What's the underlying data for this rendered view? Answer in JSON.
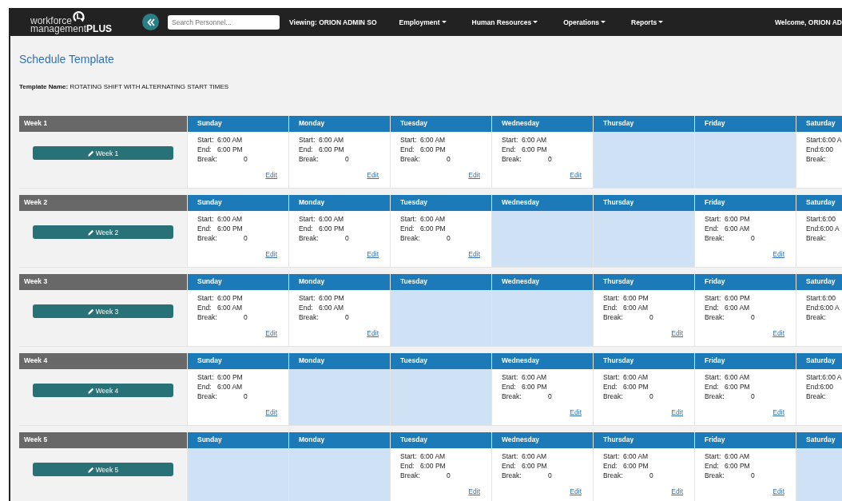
{
  "navbar": {
    "logo": {
      "line_1": "workforce",
      "line_2": "management",
      "line_3": "PLUS"
    },
    "search": {
      "placeholder": "Search Personnel..."
    },
    "viewing": "Viewing: ORION ADMIN SO",
    "menus": [
      "Employment",
      "Human Resources",
      "Operations",
      "Reports"
    ],
    "welcome": "Welcome, ORION AD"
  },
  "page_title": "Schedule Template",
  "template_name": {
    "label": "Template Name:",
    "value": "ROTATING SHIFT WITH ALTERNATING START TIMES"
  },
  "weeks": [
    {
      "label": "Week 1",
      "button": "Week 1",
      "days": [
        {
          "day": "Sunday",
          "kind": "shift",
          "start_label": "Start:",
          "start": "6:00 AM",
          "end_label": "End:",
          "end": "6:00 PM",
          "break_label": "Break:",
          "break": "0",
          "edit": "Edit"
        },
        {
          "day": "Monday",
          "kind": "shift",
          "start_label": "Start:",
          "start": "6:00 AM",
          "end_label": "End:",
          "end": "6:00 PM",
          "break_label": "Break:",
          "break": "0",
          "edit": "Edit"
        },
        {
          "day": "Tuesday",
          "kind": "shift",
          "start_label": "Start:",
          "start": "6:00 AM",
          "end_label": "End:",
          "end": "6:00 PM",
          "break_label": "Break:",
          "break": "0",
          "edit": "Edit"
        },
        {
          "day": "Wednesday",
          "kind": "shift",
          "start_label": "Start:",
          "start": "6:00 AM",
          "end_label": "End:",
          "end": "6:00 PM",
          "break_label": "Break:",
          "break": "0",
          "edit": "Edit"
        },
        {
          "day": "Thursday",
          "kind": "off"
        },
        {
          "day": "Friday",
          "kind": "off"
        },
        {
          "day": "Saturday",
          "kind": "shift",
          "start_label": "Start:",
          "start": "6:00 A",
          "end_label": "End:",
          "end": "6:00",
          "break_label": "Break:"
        }
      ]
    },
    {
      "label": "Week 2",
      "button": "Week 2",
      "days": [
        {
          "day": "Sunday",
          "kind": "shift",
          "start_label": "Start:",
          "start": "6:00 AM",
          "end_label": "End:",
          "end": "6:00 PM",
          "break_label": "Break:",
          "break": "0",
          "edit": "Edit"
        },
        {
          "day": "Monday",
          "kind": "shift",
          "start_label": "Start:",
          "start": "6:00 AM",
          "end_label": "End:",
          "end": "6:00 PM",
          "break_label": "Break:",
          "break": "0",
          "edit": "Edit"
        },
        {
          "day": "Tuesday",
          "kind": "shift",
          "start_label": "Start:",
          "start": "6:00 AM",
          "end_label": "End:",
          "end": "6:00 PM",
          "break_label": "Break:",
          "break": "0",
          "edit": "Edit"
        },
        {
          "day": "Wednesday",
          "kind": "off"
        },
        {
          "day": "Thursday",
          "kind": "off"
        },
        {
          "day": "Friday",
          "kind": "shift",
          "start_label": "Start:",
          "start": "6:00 PM",
          "end_label": "End:",
          "end": "6:00 AM",
          "break_label": "Break:",
          "break": "0",
          "edit": "Edit"
        },
        {
          "day": "Saturday",
          "kind": "shift",
          "start_label": "Start:",
          "start": "6:00",
          "end_label": "End:",
          "end": "6:00 A",
          "break_label": "Break:"
        }
      ]
    },
    {
      "label": "Week 3",
      "button": "Week 3",
      "days": [
        {
          "day": "Sunday",
          "kind": "shift",
          "start_label": "Start:",
          "start": "6:00 PM",
          "end_label": "End:",
          "end": "6:00 AM",
          "break_label": "Break:",
          "break": "0",
          "edit": "Edit"
        },
        {
          "day": "Monday",
          "kind": "shift",
          "start_label": "Start:",
          "start": "6:00 PM",
          "end_label": "End:",
          "end": "6:00 AM",
          "break_label": "Break:",
          "break": "0",
          "edit": "Edit"
        },
        {
          "day": "Tuesday",
          "kind": "off"
        },
        {
          "day": "Wednesday",
          "kind": "off"
        },
        {
          "day": "Thursday",
          "kind": "shift",
          "start_label": "Start:",
          "start": "6:00 PM",
          "end_label": "End:",
          "end": "6:00 AM",
          "break_label": "Break:",
          "break": "0",
          "edit": "Edit"
        },
        {
          "day": "Friday",
          "kind": "shift",
          "start_label": "Start:",
          "start": "6:00 PM",
          "end_label": "End:",
          "end": "6:00 AM",
          "break_label": "Break:",
          "break": "0",
          "edit": "Edit"
        },
        {
          "day": "Saturday",
          "kind": "shift",
          "start_label": "Start:",
          "start": "6:00",
          "end_label": "End:",
          "end": "6:00 A",
          "break_label": "Break:"
        }
      ]
    },
    {
      "label": "Week 4",
      "button": "Week 4",
      "days": [
        {
          "day": "Sunday",
          "kind": "shift",
          "start_label": "Start:",
          "start": "6:00 PM",
          "end_label": "End:",
          "end": "6:00 AM",
          "break_label": "Break:",
          "break": "0",
          "edit": "Edit"
        },
        {
          "day": "Monday",
          "kind": "off"
        },
        {
          "day": "Tuesday",
          "kind": "off"
        },
        {
          "day": "Wednesday",
          "kind": "shift",
          "start_label": "Start:",
          "start": "6:00 AM",
          "end_label": "End:",
          "end": "6:00 PM",
          "break_label": "Break:",
          "break": "0",
          "edit": "Edit"
        },
        {
          "day": "Thursday",
          "kind": "shift",
          "start_label": "Start:",
          "start": "6:00 AM",
          "end_label": "End:",
          "end": "6:00 PM",
          "break_label": "Break:",
          "break": "0",
          "edit": "Edit"
        },
        {
          "day": "Friday",
          "kind": "shift",
          "start_label": "Start:",
          "start": "6:00 AM",
          "end_label": "End:",
          "end": "6:00 PM",
          "break_label": "Break:",
          "break": "0",
          "edit": "Edit"
        },
        {
          "day": "Saturday",
          "kind": "shift",
          "start_label": "Start:",
          "start": "6:00 A",
          "end_label": "End:",
          "end": "6:00",
          "break_label": "Break:"
        }
      ]
    },
    {
      "label": "Week 5",
      "button": "Week 5",
      "days": [
        {
          "day": "Sunday",
          "kind": "off"
        },
        {
          "day": "Monday",
          "kind": "off"
        },
        {
          "day": "Tuesday",
          "kind": "shift",
          "start_label": "Start:",
          "start": "6:00 AM",
          "end_label": "End:",
          "end": "6:00 PM",
          "break_label": "Break:",
          "break": "0",
          "edit": "Edit"
        },
        {
          "day": "Wednesday",
          "kind": "shift",
          "start_label": "Start:",
          "start": "6:00 AM",
          "end_label": "End:",
          "end": "6:00 PM",
          "break_label": "Break:",
          "break": "0",
          "edit": "Edit"
        },
        {
          "day": "Thursday",
          "kind": "shift",
          "start_label": "Start:",
          "start": "6:00 AM",
          "end_label": "End:",
          "end": "6:00 PM",
          "break_label": "Break:",
          "break": "0",
          "edit": "Edit"
        },
        {
          "day": "Friday",
          "kind": "shift",
          "start_label": "Start:",
          "start": "6:00 AM",
          "end_label": "End:",
          "end": "6:00 PM",
          "break_label": "Break:",
          "break": "0",
          "edit": "Edit"
        },
        {
          "day": "Saturday",
          "kind": "off"
        }
      ]
    }
  ]
}
